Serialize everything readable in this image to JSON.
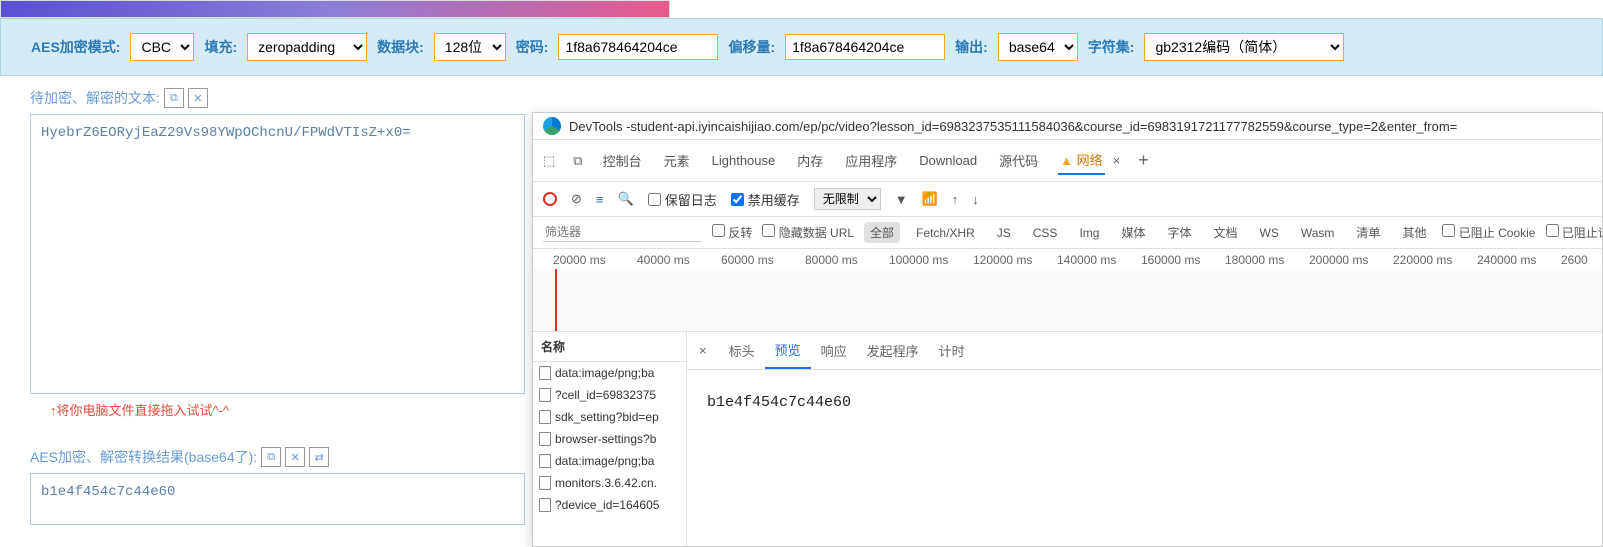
{
  "hero": {},
  "config": {
    "mode_label": "AES加密模式:",
    "mode_value": "CBC",
    "pad_label": "填充:",
    "pad_value": "zeropadding",
    "block_label": "数据块:",
    "block_value": "128位",
    "pwd_label": "密码:",
    "pwd_value": "1f8a678464204ce",
    "iv_label": "偏移量:",
    "iv_value": "1f8a678464204ce",
    "out_label": "输出:",
    "out_value": "base64",
    "charset_label": "字符集:",
    "charset_value": "gb2312编码（简体）"
  },
  "input_section": {
    "label": "待加密、解密的文本:",
    "text": "HyebrZ6EORyjEaZ29Vs98YWpOChcnU/FPWdVTIsZ+x0=",
    "hint": "↑将你电脑文件直接拖入试试^-^"
  },
  "result_section": {
    "label": "AES加密、解密转换结果(base64了):",
    "text": "b1e4f454c7c44e60"
  },
  "devtools": {
    "title_prefix": "DevTools - ",
    "title_url": "student-api.iyincaishijiao.com/ep/pc/video?lesson_id=6983237535111584036&course_id=6983191721177782559&course_type=2&enter_from=",
    "tabs": {
      "console": "控制台",
      "elements": "元素",
      "lighthouse": "Lighthouse",
      "memory": "内存",
      "application": "应用程序",
      "download": "Download",
      "sources": "源代码",
      "network": "网络"
    },
    "controls": {
      "preserve_log": "保留日志",
      "disable_cache": "禁用缓存",
      "throttle": "无限制"
    },
    "filter": {
      "placeholder": "筛选器",
      "invert": "反转",
      "hide_data_url": "隐藏数据 URL",
      "chips": [
        "全部",
        "Fetch/XHR",
        "JS",
        "CSS",
        "Img",
        "媒体",
        "字体",
        "文档",
        "WS",
        "Wasm",
        "清单",
        "其他"
      ],
      "blocked_cookies": "已阻止 Cookie",
      "blocked_requests": "已阻止请求"
    },
    "timeline": [
      "20000 ms",
      "40000 ms",
      "60000 ms",
      "80000 ms",
      "100000 ms",
      "120000 ms",
      "140000 ms",
      "160000 ms",
      "180000 ms",
      "200000 ms",
      "220000 ms",
      "240000 ms",
      "2600"
    ],
    "reqlist_header": "名称",
    "requests": [
      "data:image/png;ba",
      "?cell_id=69832375",
      "sdk_setting?bid=ep",
      "browser-settings?b",
      "data:image/png;ba",
      "monitors.3.6.42.cn.",
      "?device_id=164605"
    ],
    "detail_tabs": {
      "headers": "标头",
      "preview": "预览",
      "response": "响应",
      "initiator": "发起程序",
      "timing": "计时"
    },
    "preview_content": "b1e4f454c7c44e60"
  }
}
